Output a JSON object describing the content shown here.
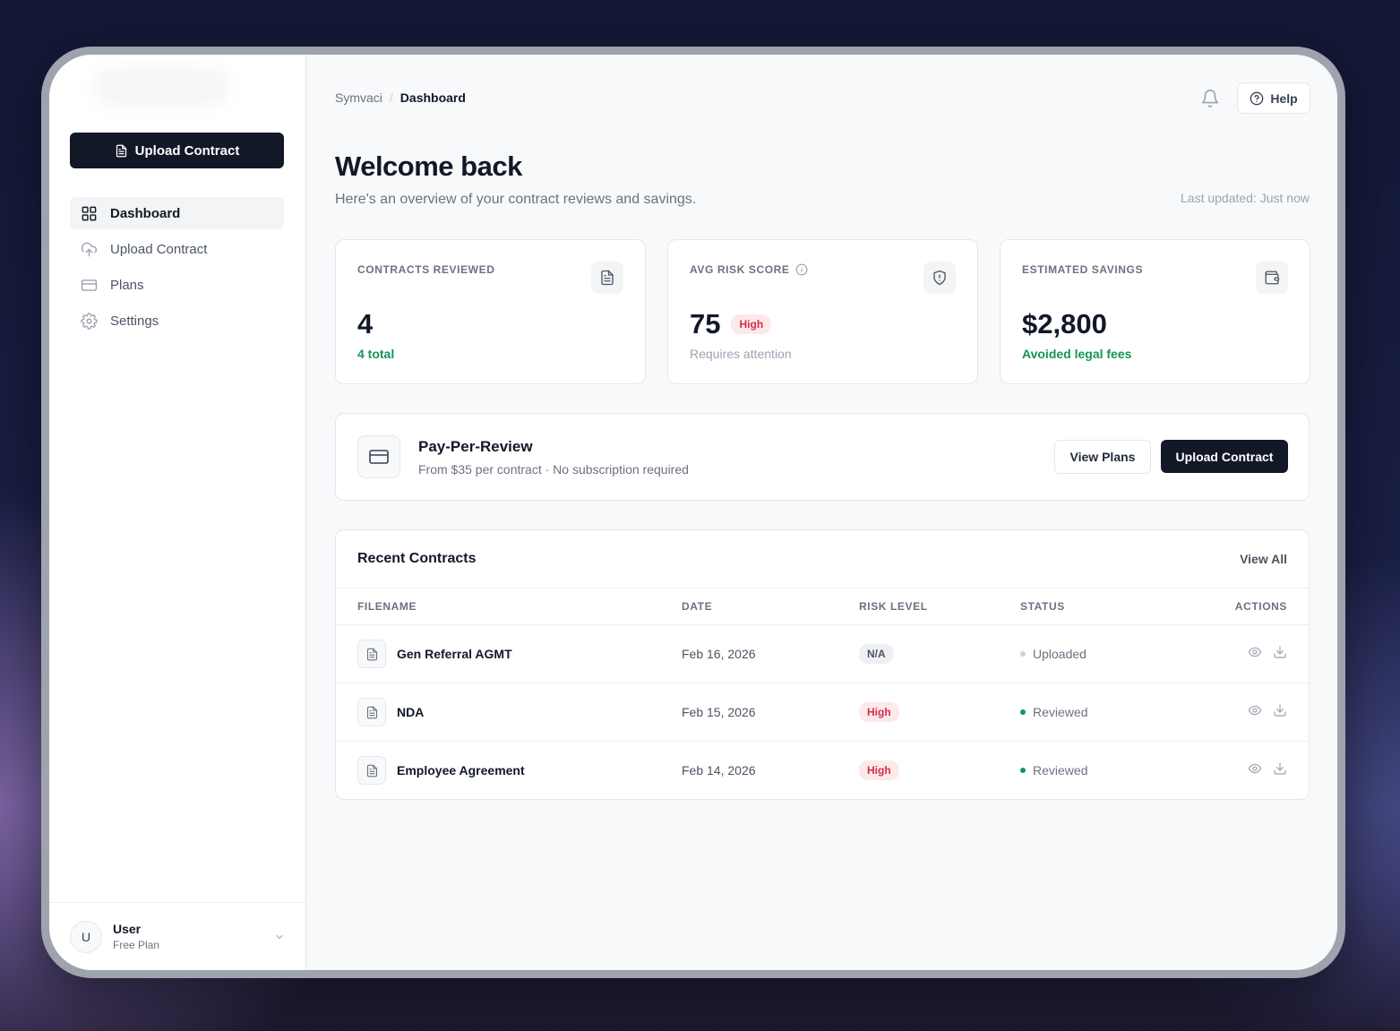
{
  "sidebar": {
    "upload_label": "Upload Contract",
    "items": [
      {
        "label": "Dashboard",
        "icon": "grid-icon",
        "active": true
      },
      {
        "label": "Upload Contract",
        "icon": "cloud-upload-icon"
      },
      {
        "label": "Plans",
        "icon": "credit-card-icon"
      },
      {
        "label": "Settings",
        "icon": "gear-icon"
      }
    ],
    "user": {
      "initial": "U",
      "name": "User",
      "plan": "Free Plan"
    }
  },
  "header": {
    "breadcrumb": [
      "Symvaci",
      "/",
      "Dashboard"
    ],
    "help_label": "Help"
  },
  "welcome": {
    "title": "Welcome back",
    "subtitle": "Here's an overview of your contract reviews and savings.",
    "updated": "Last updated: Just now"
  },
  "stats": [
    {
      "label": "CONTRACTS REVIEWED",
      "value": "4",
      "note": "4 total",
      "icon": "document-icon"
    },
    {
      "label": "AVG RISK SCORE",
      "value": "75",
      "badge": "High",
      "note": "Requires attention",
      "icon": "shield-icon"
    },
    {
      "label": "ESTIMATED SAVINGS",
      "value": "$2,800",
      "note": "Avoided legal fees",
      "icon": "wallet-icon"
    }
  ],
  "ppr": {
    "title": "Pay-Per-Review",
    "subtitle": "From $35 per contract · No subscription required",
    "view_plans": "View Plans",
    "upload": "Upload Contract"
  },
  "recent": {
    "title": "Recent Contracts",
    "view_all": "View All",
    "columns": [
      "FILENAME",
      "DATE",
      "RISK LEVEL",
      "STATUS",
      "ACTIONS"
    ],
    "rows": [
      {
        "filename": "Gen Referral AGMT",
        "date": "Feb 16, 2026",
        "risk": "N/A",
        "status": "Uploaded"
      },
      {
        "filename": "NDA",
        "date": "Feb 15, 2026",
        "risk": "High",
        "status": "Reviewed"
      },
      {
        "filename": "Employee Agreement",
        "date": "Feb 14, 2026",
        "risk": "High",
        "status": "Reviewed"
      }
    ]
  },
  "colors": {
    "primary_dark": "#121826",
    "success": "#15945a",
    "danger": "#d0304a",
    "danger_bg": "#fde8ea"
  }
}
